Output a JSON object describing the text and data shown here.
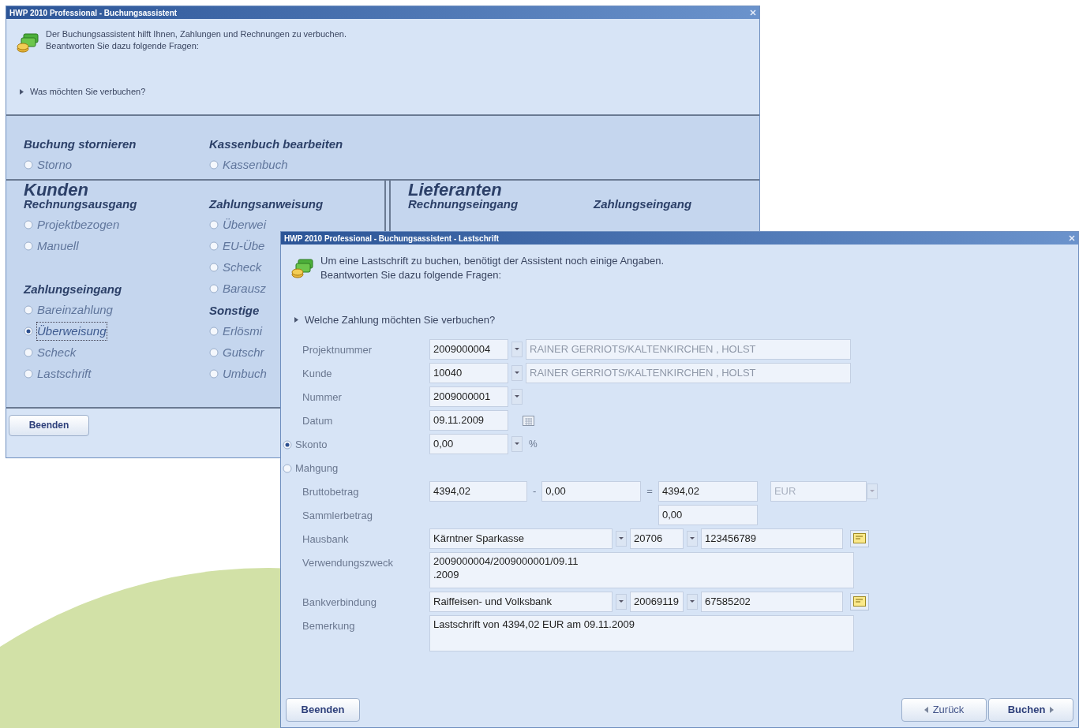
{
  "main_window": {
    "title": "HWP 2010 Professional - Buchungsassistent",
    "intro": [
      "Der Buchungsassistent hilft Ihnen, Zahlungen und Rechnungen zu verbuchen.",
      "Beantworten Sie dazu folgende Fragen:"
    ],
    "question": "Was möchten Sie verbuchen?",
    "top_groups": [
      {
        "heading": "Buchung stornieren",
        "options": [
          {
            "label": "Storno",
            "selected": false
          }
        ]
      },
      {
        "heading": "Kassenbuch bearbeiten",
        "options": [
          {
            "label": "Kassenbuch",
            "selected": false
          }
        ]
      }
    ],
    "panels": [
      {
        "title": "Kunden",
        "columns": [
          {
            "groups": [
              {
                "heading": "Rechnungsausgang",
                "options": [
                  {
                    "label": "Projektbezogen",
                    "selected": false
                  },
                  {
                    "label": "Manuell",
                    "selected": false
                  }
                ]
              },
              {
                "heading": "Zahlungseingang",
                "options": [
                  {
                    "label": "Bareinzahlung",
                    "selected": false
                  },
                  {
                    "label": "Überweisung",
                    "selected": true
                  },
                  {
                    "label": "Scheck",
                    "selected": false
                  },
                  {
                    "label": "Lastschrift",
                    "selected": false
                  }
                ]
              }
            ]
          },
          {
            "groups": [
              {
                "heading": "Zahlungsanweisung",
                "options": [
                  {
                    "label": "Überwei",
                    "selected": false
                  },
                  {
                    "label": "EU-Übe",
                    "selected": false
                  },
                  {
                    "label": "Scheck",
                    "selected": false
                  },
                  {
                    "label": "Barausz",
                    "selected": false
                  }
                ]
              },
              {
                "heading": "Sonstige",
                "options": [
                  {
                    "label": "Erlösmi",
                    "selected": false
                  },
                  {
                    "label": "Gutschr",
                    "selected": false
                  },
                  {
                    "label": "Umbuch",
                    "selected": false
                  }
                ]
              }
            ]
          }
        ]
      },
      {
        "title": "Lieferanten",
        "columns": [
          {
            "groups": [
              {
                "heading": "Rechnungseingang"
              }
            ]
          },
          {
            "groups": [
              {
                "heading": "Zahlungseingang"
              }
            ]
          }
        ]
      }
    ],
    "buttons": [
      "Beenden"
    ]
  },
  "dialog": {
    "title": "HWP 2010 Professional - Buchungsassistent - Lastschrift",
    "intro": [
      "Um eine Lastschrift zu buchen, benötigt der Assistent noch einige Angaben.",
      "Beantworten Sie dazu folgende Fragen:"
    ],
    "question": "Welche Zahlung möchten Sie verbuchen?",
    "rows": [
      {
        "kind": "lookup",
        "label": "Projektnummer",
        "value": "2009000004",
        "display": "RAINER GERRIOTS/KALTENKIRCHEN , HOLST"
      },
      {
        "kind": "lookup",
        "label": "Kunde",
        "value": "10040",
        "display": "RAINER GERRIOTS/KALTENKIRCHEN , HOLST"
      },
      {
        "kind": "combo",
        "label": "Nummer",
        "value": "2009000001"
      },
      {
        "kind": "date",
        "label": "Datum",
        "value": "09.11.2009"
      },
      {
        "kind": "option",
        "label": "Skonto",
        "selected": true,
        "value": "0,00",
        "unit": "%"
      },
      {
        "kind": "option",
        "label": "Mahgung",
        "selected": false
      },
      {
        "kind": "amount",
        "label": "Bruttobetrag",
        "gross": "4394,02",
        "minus": "-",
        "deduction": "0,00",
        "equals": "=",
        "net": "4394,02",
        "currency": "EUR",
        "currency_disabled": true
      },
      {
        "kind": "sum",
        "label": "Sammlerbetrag",
        "value": "0,00"
      },
      {
        "kind": "bank",
        "label": "Hausbank",
        "bank": "Kärntner Sparkasse",
        "code": "20706",
        "account": "123456789"
      },
      {
        "kind": "memo",
        "label": "Verwendungszweck",
        "lines": [
          "2009000004/2009000001/09.11",
          ".2009"
        ]
      },
      {
        "kind": "bank",
        "label": "Bankverbindung",
        "bank": "Raiffeisen- und Volksbank",
        "code": "20069119",
        "account": "67585202"
      },
      {
        "kind": "memo",
        "label": "Bemerkung",
        "lines": [
          "Lastschrift von 4394,02 EUR am 09.11.2009"
        ]
      }
    ],
    "left_buttons": [
      "Beenden"
    ],
    "right_buttons": [
      {
        "label": "Zurück",
        "kind": "back"
      },
      {
        "label": "Buchen",
        "kind": "next"
      }
    ]
  }
}
